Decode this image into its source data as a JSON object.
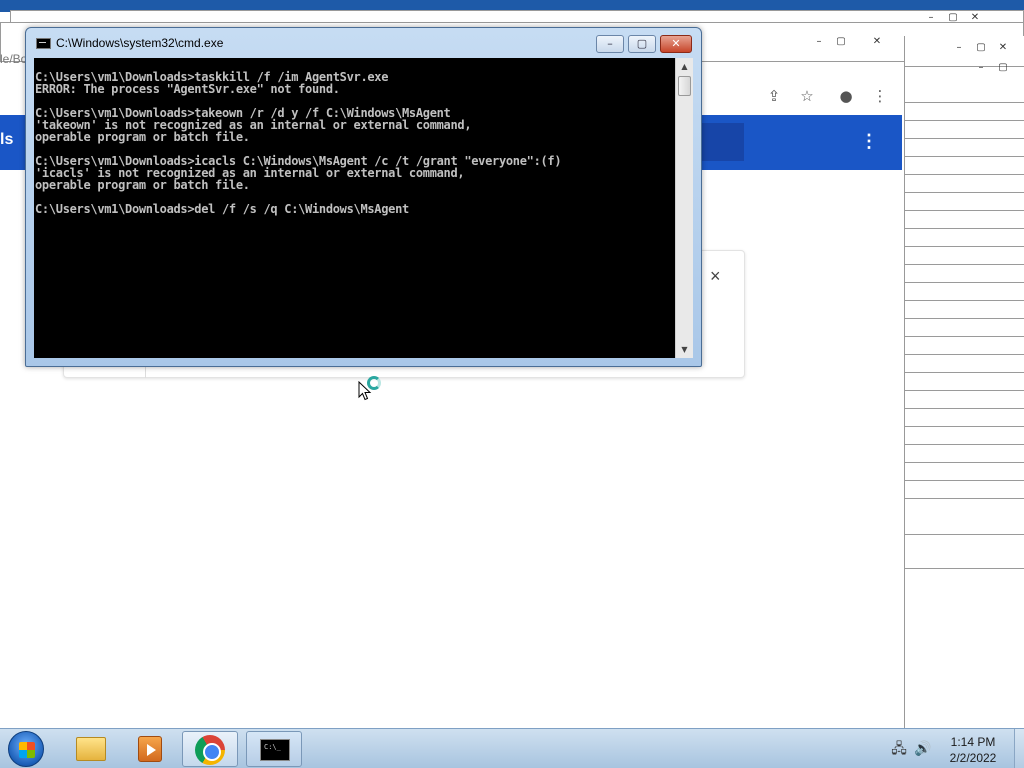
{
  "background": {
    "url_fragment": "le/Bor",
    "band_fragment": "ls",
    "card_close": "×",
    "kebab": "⋮",
    "bg_window_controls": [
      "–",
      "▢",
      "✕"
    ]
  },
  "cmd_window": {
    "title": "C:\\Windows\\system32\\cmd.exe",
    "controls": {
      "minimize": "–",
      "maximize": "▢",
      "close": "✕"
    },
    "lines": [
      "C:\\Users\\vm1\\Downloads>taskkill /f /im AgentSvr.exe",
      "ERROR: The process \"AgentSvr.exe\" not found.",
      "",
      "C:\\Users\\vm1\\Downloads>takeown /r /d y /f C:\\Windows\\MsAgent",
      "'takeown' is not recognized as an internal or external command,",
      "operable program or batch file.",
      "",
      "C:\\Users\\vm1\\Downloads>icacls C:\\Windows\\MsAgent /c /t /grant \"everyone\":(f)",
      "'icacls' is not recognized as an internal or external command,",
      "operable program or batch file.",
      "",
      "C:\\Users\\vm1\\Downloads>del /f /s /q C:\\Windows\\MsAgent"
    ],
    "scroll_up": "▲",
    "scroll_down": "▼"
  },
  "taskbar": {
    "cmd_icon_text": "C:\\_",
    "tray": {
      "network": "🖧",
      "volume": "🔊"
    },
    "clock": {
      "time": "1:14 PM",
      "date": "2/2/2022"
    }
  }
}
